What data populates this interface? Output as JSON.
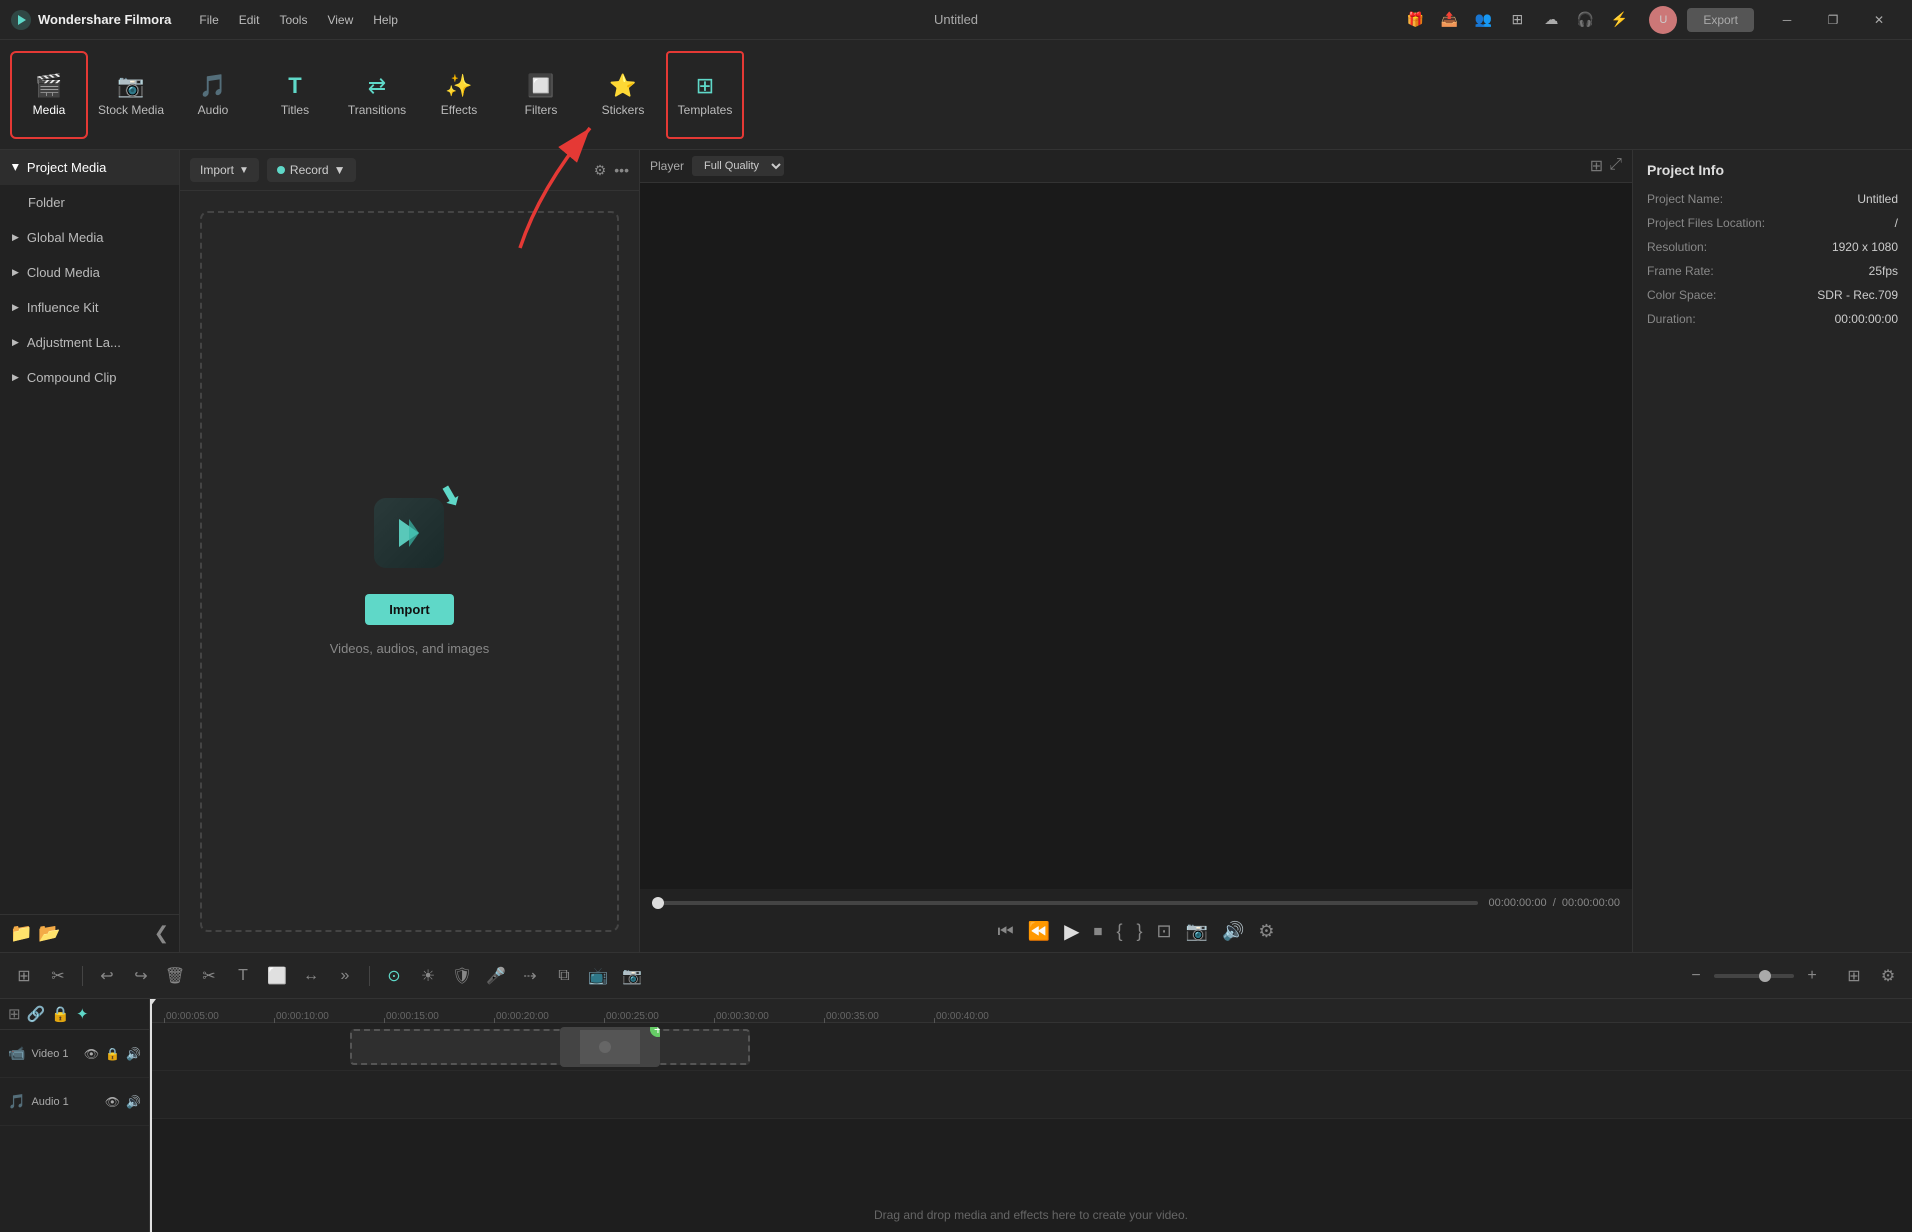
{
  "app": {
    "name": "Wondershare Filmora",
    "title": "Untitled"
  },
  "titlebar": {
    "menu_items": [
      "File",
      "Edit",
      "Tools",
      "View",
      "Help"
    ],
    "window_controls": [
      "─",
      "❐",
      "✕"
    ],
    "export_label": "Export"
  },
  "toolbar": {
    "tabs": [
      {
        "id": "media",
        "label": "Media",
        "icon": "🎬",
        "active": true
      },
      {
        "id": "stock_media",
        "label": "Stock Media",
        "icon": "📷"
      },
      {
        "id": "audio",
        "label": "Audio",
        "icon": "🎵"
      },
      {
        "id": "titles",
        "label": "Titles",
        "icon": "T"
      },
      {
        "id": "transitions",
        "label": "Transitions",
        "icon": "⇄"
      },
      {
        "id": "effects",
        "label": "Effects",
        "icon": "✨"
      },
      {
        "id": "filters",
        "label": "Filters",
        "icon": "🔲"
      },
      {
        "id": "stickers",
        "label": "Stickers",
        "icon": "⭐"
      },
      {
        "id": "templates",
        "label": "Templates",
        "icon": "⊞",
        "highlighted": true
      }
    ]
  },
  "sidebar": {
    "items": [
      {
        "id": "project_media",
        "label": "Project Media",
        "active": true,
        "expanded": true
      },
      {
        "id": "folder",
        "label": "Folder",
        "indent": true
      },
      {
        "id": "global_media",
        "label": "Global Media"
      },
      {
        "id": "cloud_media",
        "label": "Cloud Media"
      },
      {
        "id": "influence_kit",
        "label": "Influence Kit"
      },
      {
        "id": "adjustment_layer",
        "label": "Adjustment La..."
      },
      {
        "id": "compound_clip",
        "label": "Compound Clip"
      }
    ],
    "bottom_icons": [
      "📁",
      "📂"
    ],
    "collapse_icon": "❮"
  },
  "media_panel": {
    "import_label": "Import",
    "record_label": "Record",
    "drop_hint": "Videos, audios, and images",
    "import_button": "Import"
  },
  "player": {
    "label": "Player",
    "quality": "Full Quality",
    "current_time": "00:00:00:00",
    "total_time": "00:00:00:00"
  },
  "project_info": {
    "title": "Project Info",
    "fields": [
      {
        "label": "Project Name:",
        "value": "Untitled"
      },
      {
        "label": "Project Files Location:",
        "value": "/"
      },
      {
        "label": "Resolution:",
        "value": "1920 x 1080"
      },
      {
        "label": "Frame Rate:",
        "value": "25fps"
      },
      {
        "label": "Color Space:",
        "value": "SDR - Rec.709"
      },
      {
        "label": "Duration:",
        "value": "00:00:00:00"
      }
    ]
  },
  "timeline": {
    "ruler_marks": [
      "00:00:05:00",
      "00:00:10:00",
      "00:00:15:00",
      "00:00:20:00",
      "00:00:25:00",
      "00:00:30:00",
      "00:00:35:00",
      "00:00:40:00"
    ],
    "tracks": [
      {
        "id": "video1",
        "label": "Video 1",
        "type": "video"
      },
      {
        "id": "audio1",
        "label": "Audio 1",
        "type": "audio"
      }
    ],
    "drag_hint": "Drag and drop media and effects here to create your video."
  },
  "colors": {
    "accent": "#5fd8c8",
    "highlight_red": "#e53935",
    "bg_dark": "#1a1a1a",
    "bg_panel": "#252525"
  }
}
